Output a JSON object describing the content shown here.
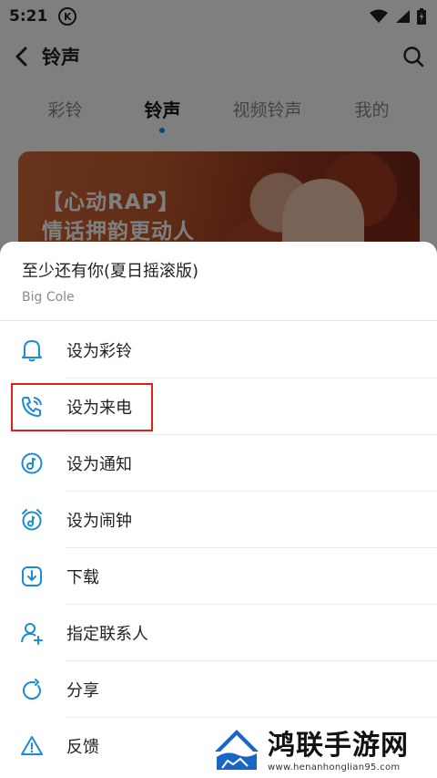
{
  "status_bar": {
    "time": "5:21",
    "app_badge": "K"
  },
  "header": {
    "title": "铃声"
  },
  "tabs": [
    {
      "label": "彩铃",
      "active": false
    },
    {
      "label": "铃声",
      "active": true
    },
    {
      "label": "视频铃声",
      "active": false
    },
    {
      "label": "我的",
      "active": false
    }
  ],
  "banner": {
    "line1": "【心动RAP】",
    "line2": "情话押韵更动人"
  },
  "sheet": {
    "song_title": "至少还有你(夏日摇滚版)",
    "artist": "Big Cole",
    "items": [
      {
        "label": "设为彩铃",
        "icon": "bell-icon"
      },
      {
        "label": "设为来电",
        "icon": "phone-ring-icon",
        "highlighted": true
      },
      {
        "label": "设为通知",
        "icon": "notification-icon"
      },
      {
        "label": "设为闹钟",
        "icon": "alarm-clock-icon"
      },
      {
        "label": "下载",
        "icon": "download-icon"
      },
      {
        "label": "指定联系人",
        "icon": "add-contact-icon"
      },
      {
        "label": "分享",
        "icon": "share-icon"
      },
      {
        "label": "反馈",
        "icon": "warning-icon"
      }
    ]
  },
  "watermark": {
    "title": "鸿联手游网",
    "url": "www.henanhonglian95.com"
  },
  "colors": {
    "accent": "#1a8cd8",
    "highlight_box": "#e0201d"
  }
}
